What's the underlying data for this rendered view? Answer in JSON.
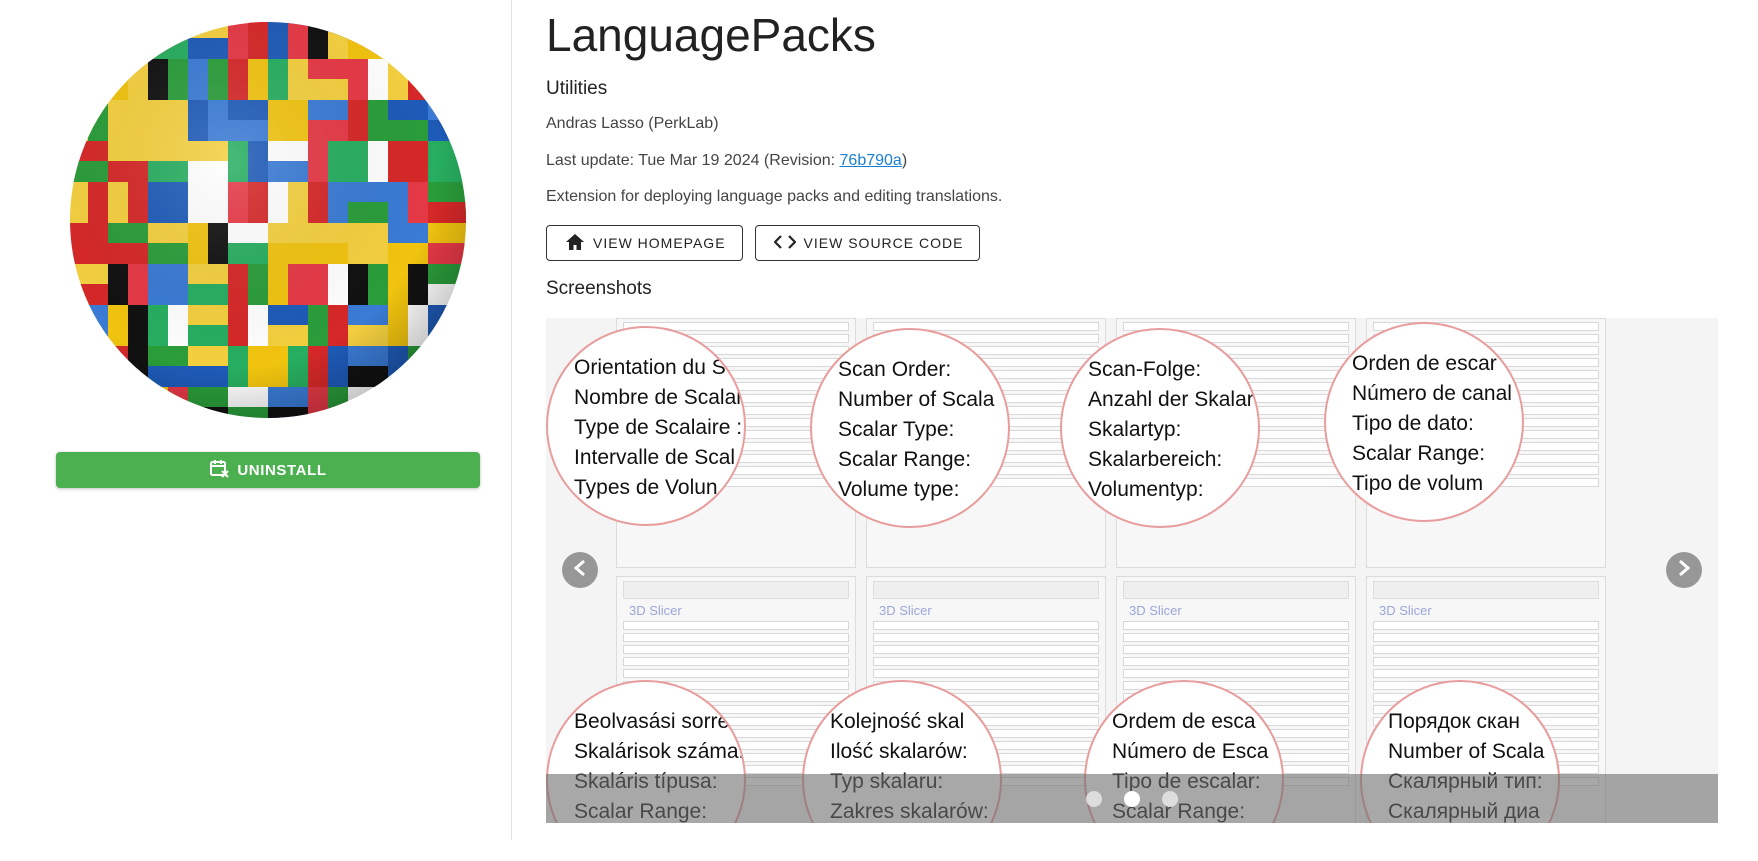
{
  "extension": {
    "title": "LanguagePacks",
    "category": "Utilities",
    "author": "Andras Lasso (PerkLab)",
    "last_update_prefix": "Last update: Tue Mar 19 2024  (Revision: ",
    "revision": "76b790a",
    "last_update_suffix": ")",
    "description": "Extension for deploying language packs and editing translations."
  },
  "actions": {
    "uninstall_label": "UNINSTALL",
    "homepage_label": "VIEW HOMEPAGE",
    "source_label": "VIEW SOURCE CODE"
  },
  "screenshots": {
    "heading": "Screenshots",
    "slide_count": 3,
    "active_slide": 1,
    "magnifier_labels": [
      [
        "Orientation du S",
        "Nombre de Scalai",
        "Type de Scalaire :",
        "Intervalle de Scal",
        "Types de Volun"
      ],
      [
        "Scan Order:",
        "Number of Scala",
        "Scalar Type:",
        "Scalar Range:",
        "Volume type:"
      ],
      [
        "Scan-Folge:",
        "Anzahl der Skalar",
        "Skalartyp:",
        "Skalarbereich:",
        "Volumentyp:"
      ],
      [
        "Orden de escar",
        "Número de canal",
        "Tipo de dato:",
        "Scalar Range:",
        "Tipo de volum"
      ],
      [
        "Beolvasási sorrer",
        "Skalárisok száma:",
        "Skaláris típusa:",
        "Scalar Range:"
      ],
      [
        "Kolejność skal",
        "Ilość skalarów:",
        "Typ skalaru:",
        "Zakres skalarów:"
      ],
      [
        "Ordem de esca",
        "Número de Esca",
        "Tipo de escalar:",
        "Scalar Range:"
      ],
      [
        "Порядок скан",
        "Number of Scala",
        "Скалярный тип:",
        "Скалярный диа"
      ]
    ],
    "app_name_label": "3D Slicer"
  },
  "colors": {
    "uninstall_bg": "#4caf50",
    "link": "#1a7fd4",
    "magnifier_border": "#e89c9c"
  }
}
